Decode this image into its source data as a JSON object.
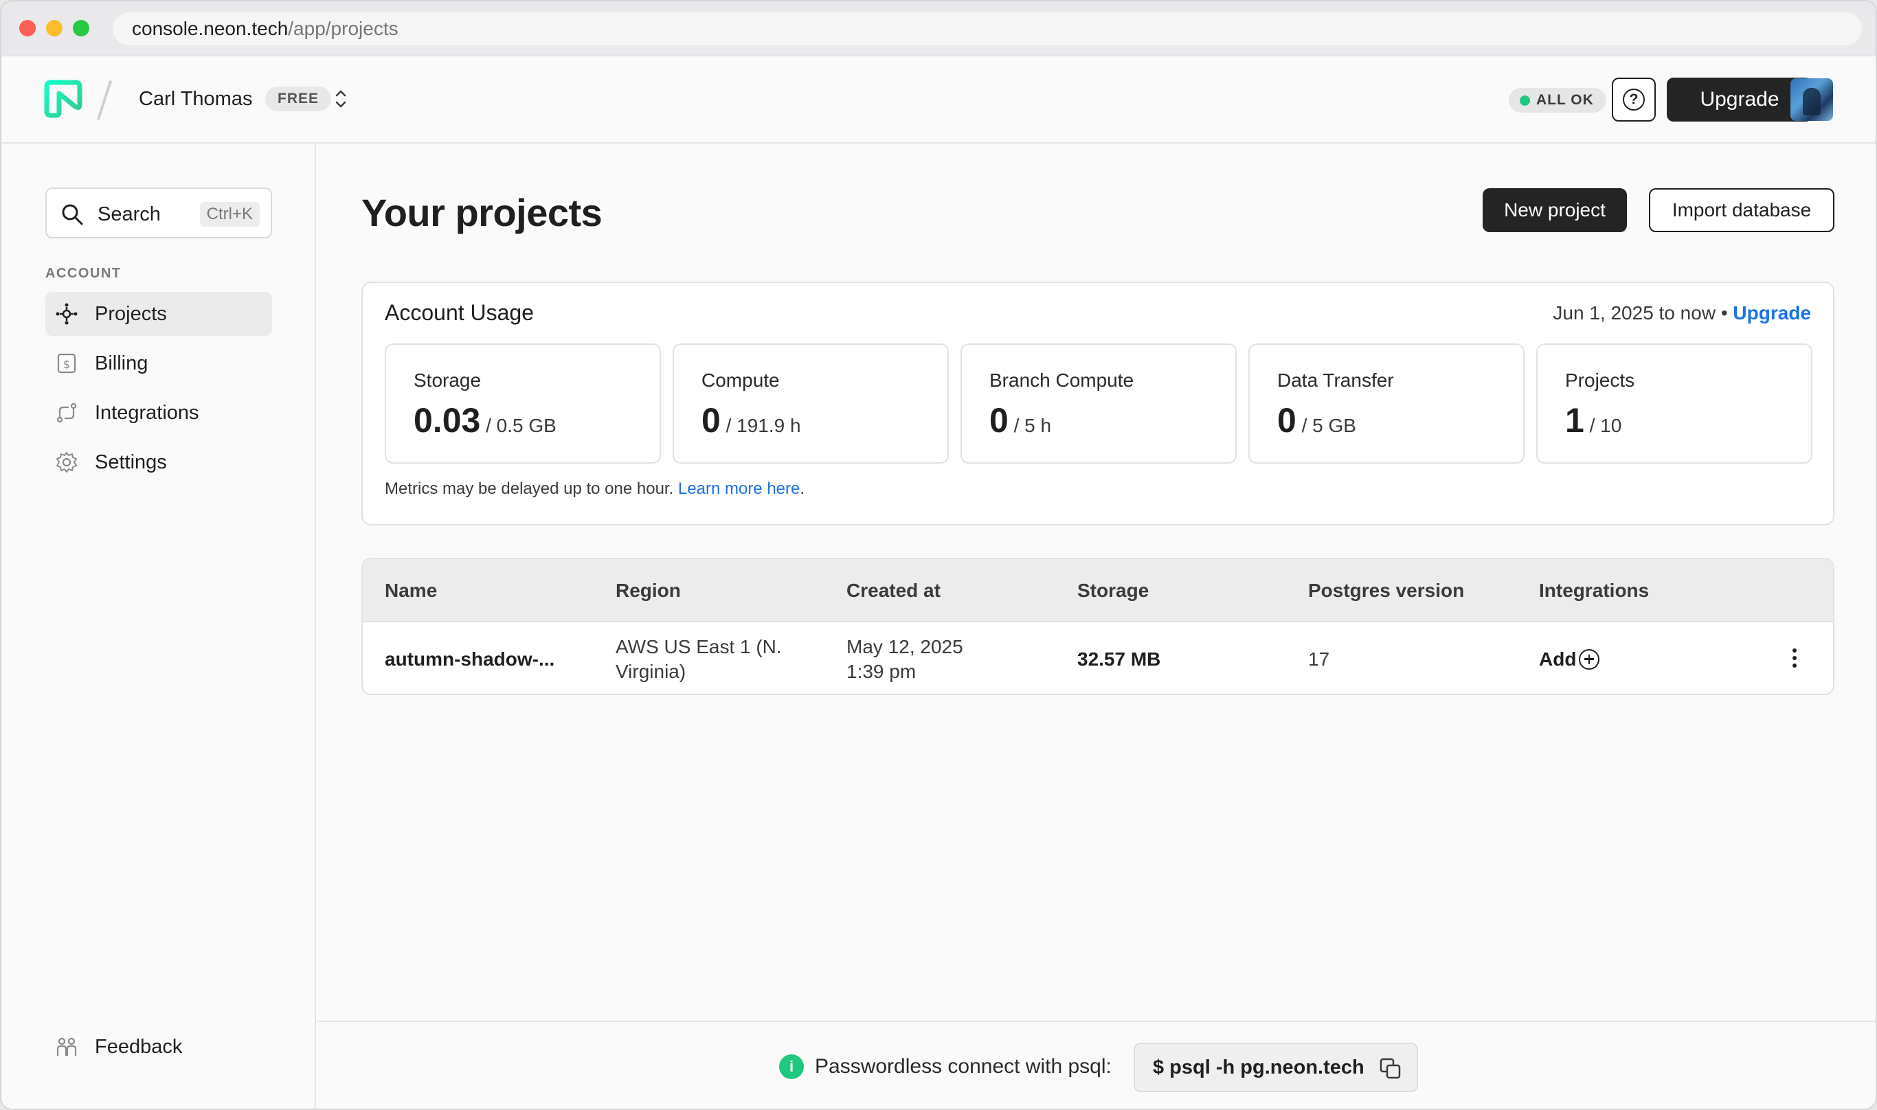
{
  "browser": {
    "url_host": "console.neon.tech",
    "url_path": "/app/projects"
  },
  "header": {
    "org_name": "Carl Thomas",
    "plan_badge": "FREE",
    "status": "ALL OK",
    "help_icon": "question-circle-icon",
    "upgrade_label": "Upgrade"
  },
  "sidebar": {
    "search_label": "Search",
    "search_shortcut": "Ctrl+K",
    "section_label": "ACCOUNT",
    "items": [
      {
        "label": "Projects",
        "icon": "projects-icon",
        "active": true
      },
      {
        "label": "Billing",
        "icon": "billing-icon",
        "active": false
      },
      {
        "label": "Integrations",
        "icon": "integrations-icon",
        "active": false
      },
      {
        "label": "Settings",
        "icon": "gear-icon",
        "active": false
      }
    ],
    "feedback_label": "Feedback"
  },
  "main": {
    "title": "Your projects",
    "new_project_label": "New project",
    "import_label": "Import database",
    "usage": {
      "title": "Account Usage",
      "period": "Jun 1, 2025 to now",
      "separator": "•",
      "upgrade_link": "Upgrade",
      "metrics": [
        {
          "label": "Storage",
          "value": "0.03",
          "limit": "/ 0.5 GB"
        },
        {
          "label": "Compute",
          "value": "0",
          "limit": "/ 191.9 h"
        },
        {
          "label": "Branch Compute",
          "value": "0",
          "limit": "/ 5 h"
        },
        {
          "label": "Data Transfer",
          "value": "0",
          "limit": "/ 5 GB"
        },
        {
          "label": "Projects",
          "value": "1",
          "limit": "/ 10"
        }
      ],
      "note": "Metrics may be delayed up to one hour.",
      "note_link": "Learn more here",
      "note_end": "."
    },
    "table": {
      "columns": [
        "Name",
        "Region",
        "Created at",
        "Storage",
        "Postgres version",
        "Integrations"
      ],
      "rows": [
        {
          "name": "autumn-shadow-...",
          "region_line1": "AWS US East 1 (N.",
          "region_line2": "Virginia)",
          "created_line1": "May 12, 2025",
          "created_line2": "1:39 pm",
          "storage": "32.57 MB",
          "pg_version": "17",
          "integrations": "Add"
        }
      ]
    }
  },
  "footer": {
    "info_text": "Passwordless connect with psql:",
    "command": "$ psql -h pg.neon.tech"
  },
  "colors": {
    "accent_link": "#1a73e8",
    "status_green": "#1fc77f",
    "dark_button": "#242424"
  }
}
